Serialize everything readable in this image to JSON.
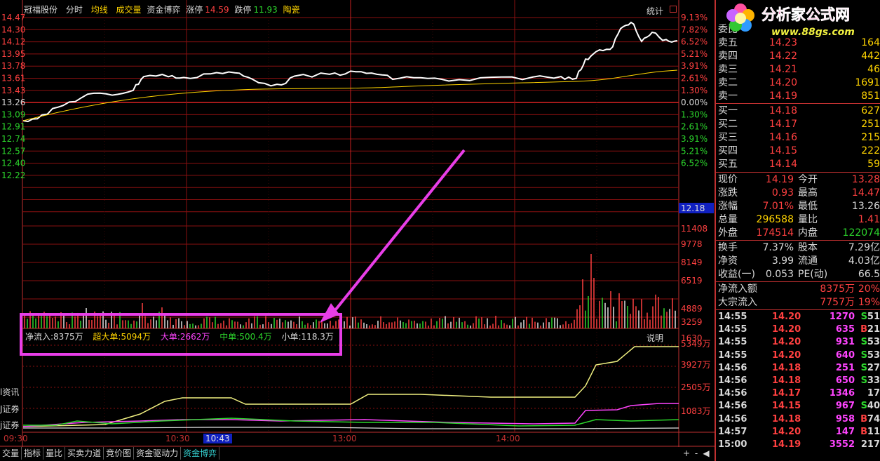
{
  "header": {
    "stock_name": "冠福股份",
    "items": [
      "分时",
      "均线",
      "成交量",
      "资金博弈"
    ],
    "limit_up_label": "涨停",
    "limit_up_value": "14.59",
    "limit_down_label": "跌停",
    "limit_down_value": "11.93",
    "sector": "陶瓷",
    "stats_button": "统计"
  },
  "price_axis_left": [
    "14.47",
    "14.30",
    "14.12",
    "13.95",
    "13.78",
    "13.61",
    "13.43",
    "13.26",
    "13.09",
    "12.91",
    "12.74",
    "12.57",
    "12.40",
    "12.22"
  ],
  "pct_axis_right": [
    "9.13%",
    "7.82%",
    "6.52%",
    "5.21%",
    "3.91%",
    "2.61%",
    "1.30%",
    "0.00%",
    "1.30%",
    "2.61%",
    "3.91%",
    "5.21%",
    "6.52%"
  ],
  "volume_axis_right": [
    "12.18",
    "11408",
    "9778",
    "8149",
    "6519",
    "4889",
    "3259",
    "1630"
  ],
  "flow_axis_right": [
    "5349万",
    "3927万",
    "2505万",
    "1083万"
  ],
  "time_axis": [
    "09:30",
    "10:30",
    "13:00",
    "14:00"
  ],
  "cursor_time": "10:43",
  "flow_legend": {
    "net_inflow": "净流入:8375万",
    "super_large": "超大单:5094万",
    "large": "大单:2662万",
    "medium": "中单:500.4万",
    "small": "小单:118.3万",
    "explain_button": "说明"
  },
  "left_clipped": [
    "l资讯",
    "J证券",
    "j证券"
  ],
  "bottom_tabs": [
    "交量",
    "指标",
    "量比",
    "买卖力道",
    "竞价图",
    "资金驱动力",
    "资金博弈"
  ],
  "tab_controls": [
    "+",
    "-",
    "◀"
  ],
  "logo": {
    "title": "分析家公式网",
    "url": "www.88gs.com"
  },
  "order_book": {
    "weibi_label": "委比",
    "asks": [
      {
        "label": "卖五",
        "price": "14.23",
        "vol": "164"
      },
      {
        "label": "卖四",
        "price": "14.22",
        "vol": "442"
      },
      {
        "label": "卖三",
        "price": "14.21",
        "vol": "46"
      },
      {
        "label": "卖二",
        "price": "14.20",
        "vol": "1691"
      },
      {
        "label": "卖一",
        "price": "14.19",
        "vol": "851"
      }
    ],
    "bids": [
      {
        "label": "买一",
        "price": "14.18",
        "vol": "627"
      },
      {
        "label": "买二",
        "price": "14.17",
        "vol": "251"
      },
      {
        "label": "买三",
        "price": "14.16",
        "vol": "215"
      },
      {
        "label": "买四",
        "price": "14.15",
        "vol": "222"
      },
      {
        "label": "买五",
        "price": "14.14",
        "vol": "59"
      }
    ]
  },
  "quote": [
    {
      "l1": "现价",
      "v1": "14.19",
      "c1": "#ff4040",
      "l2": "今开",
      "v2": "13.28",
      "c2": "#ff4040"
    },
    {
      "l1": "涨跌",
      "v1": "0.93",
      "c1": "#ff4040",
      "l2": "最高",
      "v2": "14.47",
      "c2": "#ff4040"
    },
    {
      "l1": "涨幅",
      "v1": "7.01%",
      "c1": "#ff4040",
      "l2": "最低",
      "v2": "13.26",
      "c2": "#d8d8d8"
    },
    {
      "l1": "总量",
      "v1": "296588",
      "c1": "#ffd400",
      "l2": "量比",
      "v2": "1.41",
      "c2": "#ff4040"
    },
    {
      "l1": "外盘",
      "v1": "174514",
      "c1": "#ff4040",
      "l2": "内盘",
      "v2": "122074",
      "c2": "#2cd62c"
    }
  ],
  "fundamentals": [
    {
      "l1": "换手",
      "v1": "7.37%",
      "l2": "股本",
      "v2": "7.29亿"
    },
    {
      "l1": "净资",
      "v1": "3.99",
      "l2": "流通",
      "v2": "4.03亿"
    },
    {
      "l1": "收益(一)",
      "v1": "0.053",
      "l2": "PE(动)",
      "v2": "66.5"
    }
  ],
  "flows": [
    {
      "label": "净流入额",
      "v1": "8375万",
      "v2": "20%"
    },
    {
      "label": "大宗流入",
      "v1": "7757万",
      "v2": "19%"
    }
  ],
  "ticks": [
    {
      "t": "14:55",
      "p": "14.20",
      "v": "1270",
      "bs": "S",
      "n": "51"
    },
    {
      "t": "14:55",
      "p": "14.20",
      "v": "635",
      "bs": "B",
      "n": "21"
    },
    {
      "t": "14:55",
      "p": "14.20",
      "v": "931",
      "bs": "S",
      "n": "53"
    },
    {
      "t": "14:55",
      "p": "14.20",
      "v": "640",
      "bs": "S",
      "n": "53"
    },
    {
      "t": "14:56",
      "p": "14.18",
      "v": "251",
      "bs": "S",
      "n": "27"
    },
    {
      "t": "14:56",
      "p": "14.18",
      "v": "650",
      "bs": "S",
      "n": "33"
    },
    {
      "t": "14:56",
      "p": "14.17",
      "v": "1346",
      "bs": "",
      "n": "17"
    },
    {
      "t": "14:56",
      "p": "14.15",
      "v": "967",
      "bs": "S",
      "n": "40"
    },
    {
      "t": "14:56",
      "p": "14.18",
      "v": "958",
      "bs": "B",
      "n": "74"
    },
    {
      "t": "14:57",
      "p": "14.20",
      "v": "147",
      "bs": "B",
      "n": "11"
    },
    {
      "t": "15:00",
      "p": "14.19",
      "v": "3552",
      "bs": "",
      "n": "217"
    }
  ],
  "colors": {
    "up": "#ff4040",
    "down": "#2cd62c",
    "grid": "#8a1010",
    "accent": "#e83ee8",
    "yellow": "#ffd400",
    "magenta": "#ff44ff",
    "cyan": "#33cccc"
  }
}
